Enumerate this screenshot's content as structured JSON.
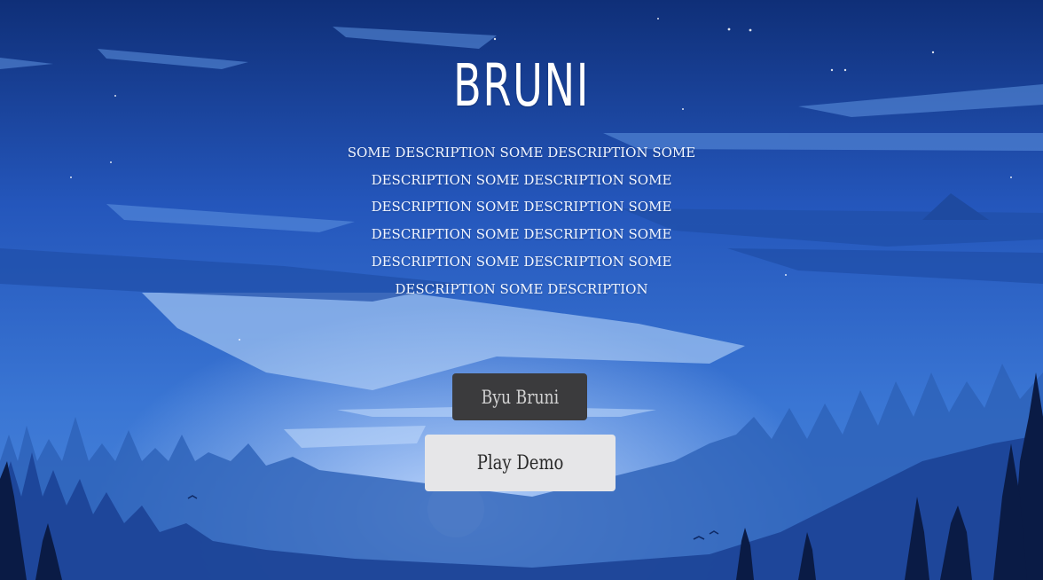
{
  "hero": {
    "title": "BRUNI",
    "description": "SOME DESCRIPTION SOME DESCRIPTION SOME DESCRIPTION SOME DESCRIPTION SOME DESCRIPTION SOME DESCRIPTION SOME DESCRIPTION SOME DESCRIPTION SOME DESCRIPTION SOME DESCRIPTION SOME DESCRIPTION SOME DESCRIPTION"
  },
  "actions": {
    "buy_label": "Byu Bruni",
    "demo_label": "Play Demo"
  },
  "colors": {
    "sky_top": "#0f2f78",
    "sky_mid": "#2a62c4",
    "sky_light": "#8fb4ec",
    "buy_button_bg": "#3b3b3d",
    "demo_button_bg": "#e6e6e8"
  },
  "background": {
    "icon": "night-forest-landscape"
  }
}
